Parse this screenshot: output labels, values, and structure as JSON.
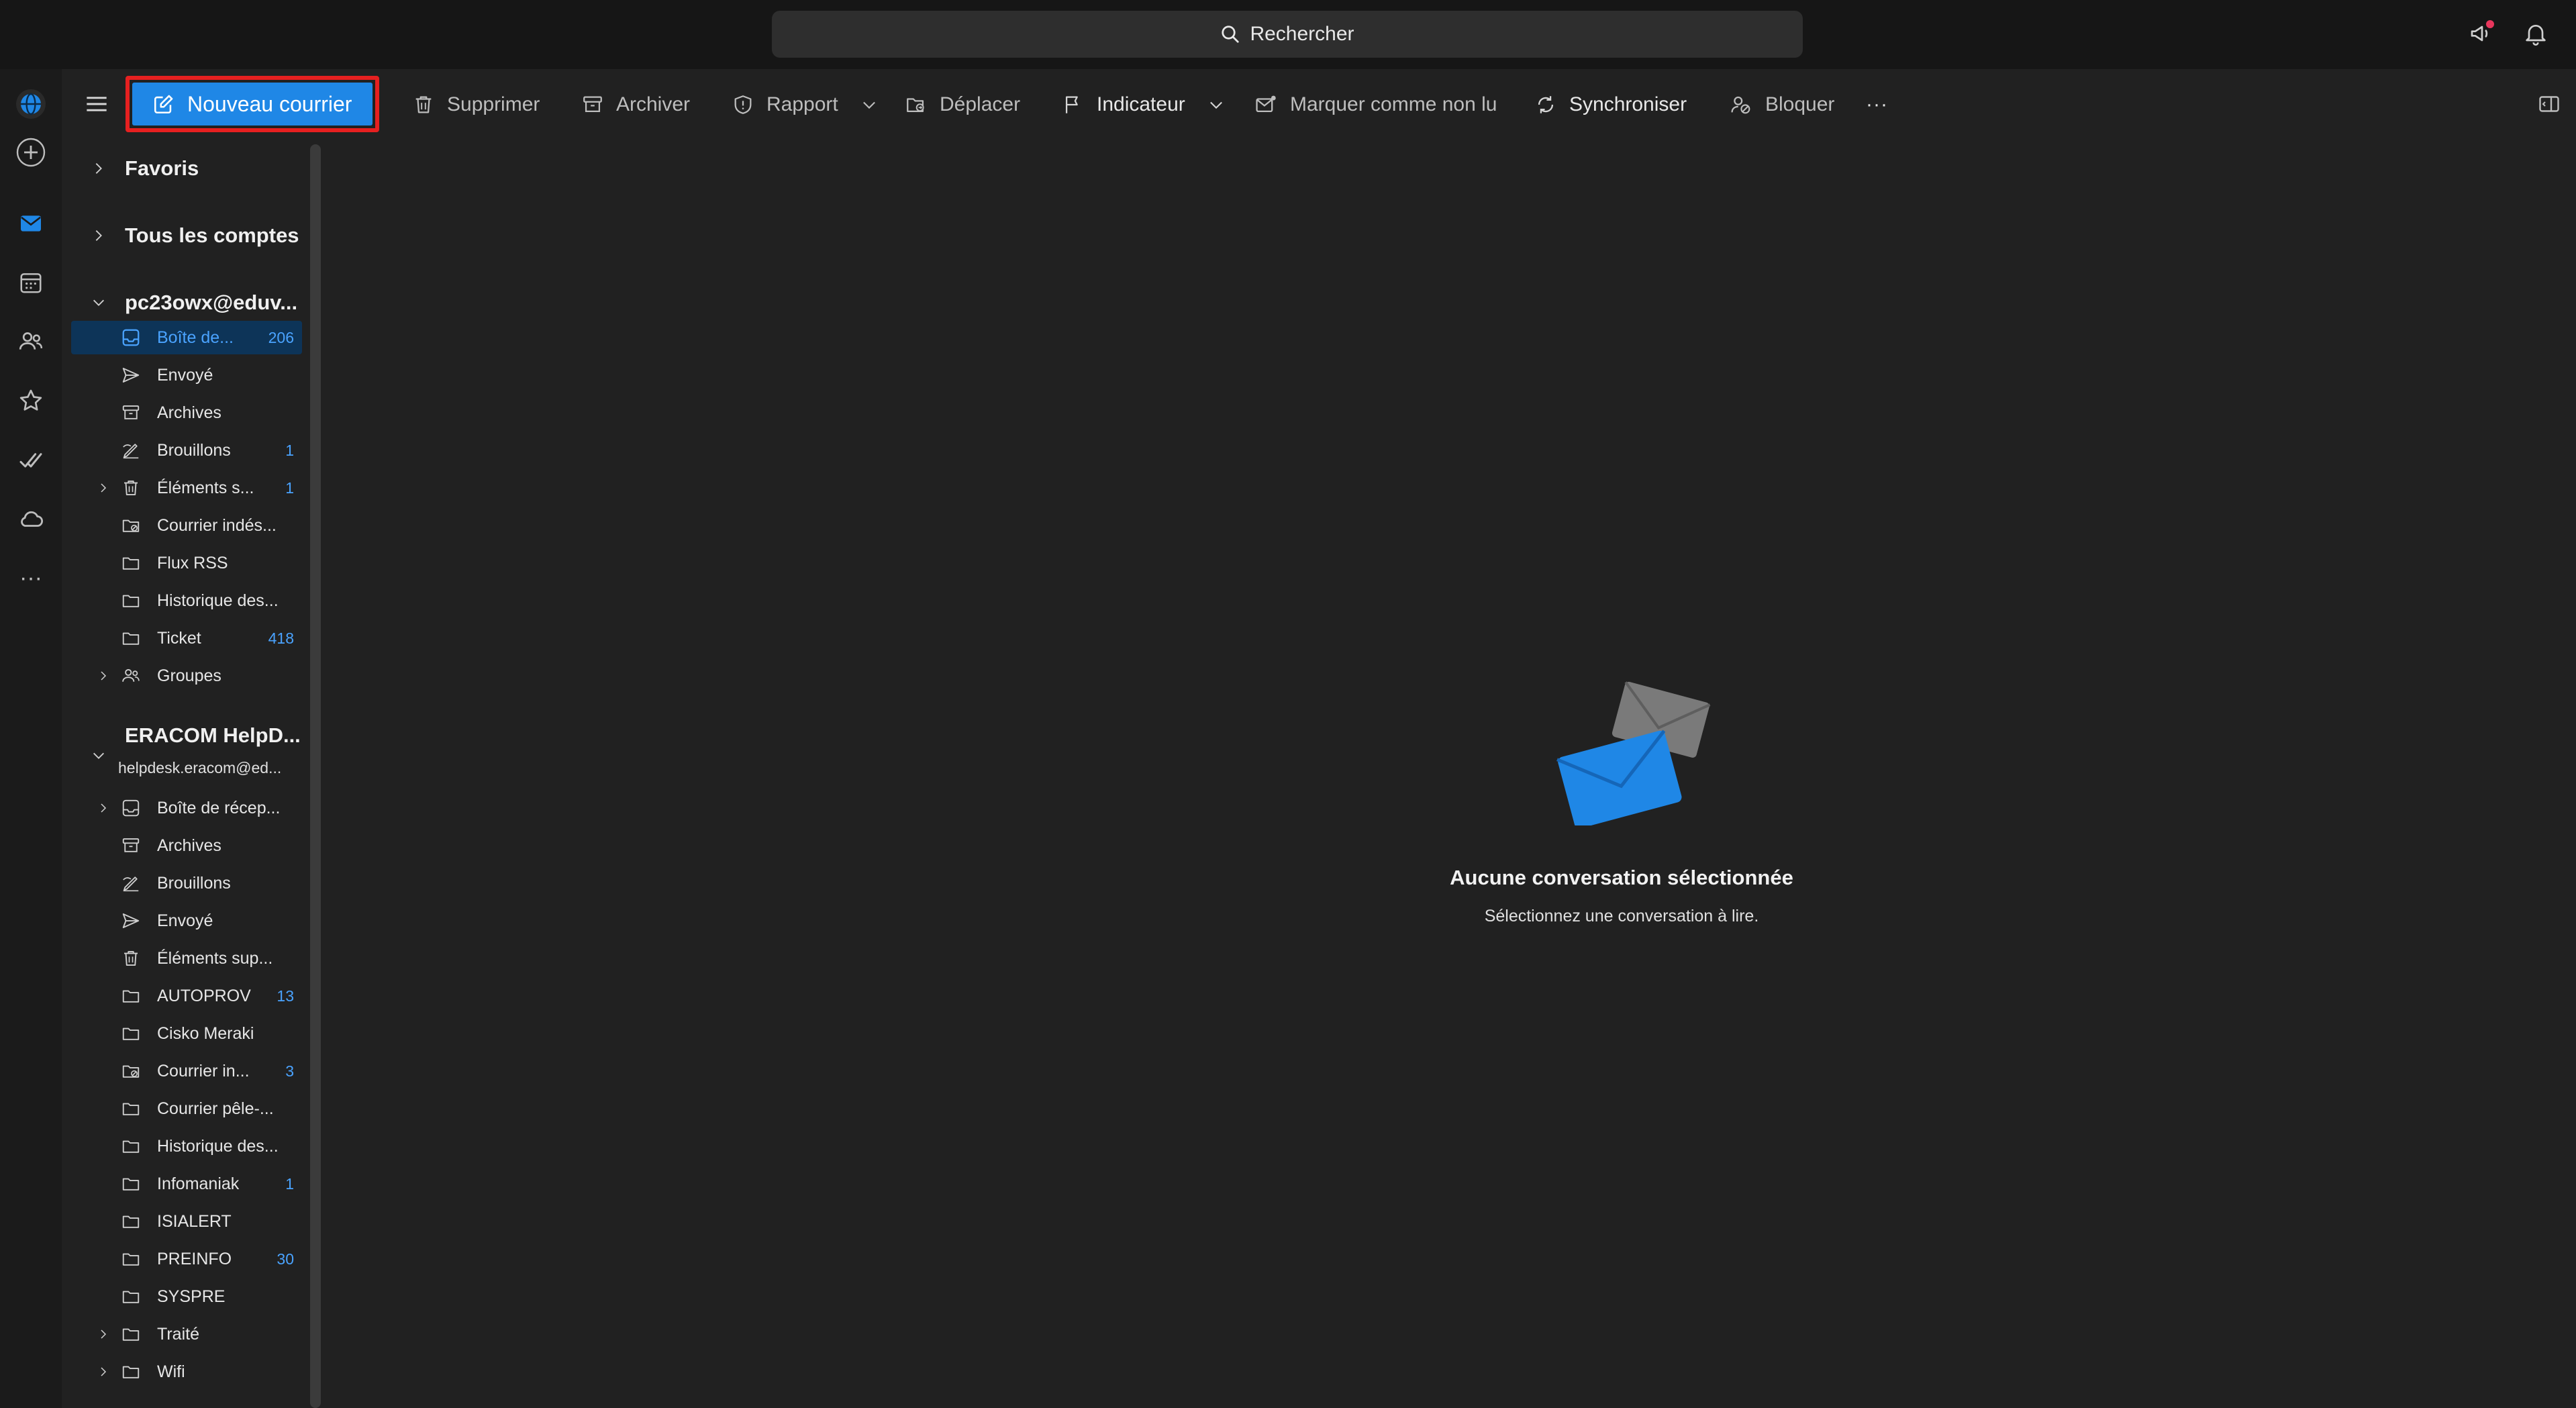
{
  "search": {
    "label": "Rechercher"
  },
  "toolbar": {
    "new_mail": "Nouveau courrier",
    "delete": "Supprimer",
    "archive": "Archiver",
    "report": "Rapport",
    "move": "Déplacer",
    "flag": "Indicateur",
    "mark_unread": "Marquer comme non lu",
    "sync": "Synchroniser",
    "block": "Bloquer",
    "more": "···"
  },
  "rail": {
    "more": "···"
  },
  "folders": {
    "favorites": "Favoris",
    "all_accounts": "Tous les comptes",
    "account1": {
      "name": "pc23owx@eduv...",
      "items": [
        {
          "label": "Boîte de...",
          "count": "206"
        },
        {
          "label": "Envoyé",
          "count": ""
        },
        {
          "label": "Archives",
          "count": ""
        },
        {
          "label": "Brouillons",
          "count": "1"
        },
        {
          "label": "Éléments s...",
          "count": "1"
        },
        {
          "label": "Courrier indés...",
          "count": ""
        },
        {
          "label": "Flux RSS",
          "count": ""
        },
        {
          "label": "Historique des...",
          "count": ""
        },
        {
          "label": "Ticket",
          "count": "418"
        },
        {
          "label": "Groupes",
          "count": ""
        }
      ]
    },
    "account2": {
      "name": "ERACOM HelpD...",
      "email": "helpdesk.eracom@ed...",
      "items": [
        {
          "label": "Boîte de récep...",
          "count": ""
        },
        {
          "label": "Archives",
          "count": ""
        },
        {
          "label": "Brouillons",
          "count": ""
        },
        {
          "label": "Envoyé",
          "count": ""
        },
        {
          "label": "Éléments sup...",
          "count": ""
        },
        {
          "label": "AUTOPROV",
          "count": "13"
        },
        {
          "label": "Cisko Meraki",
          "count": ""
        },
        {
          "label": "Courrier in...",
          "count": "3"
        },
        {
          "label": "Courrier pêle-...",
          "count": ""
        },
        {
          "label": "Historique des...",
          "count": ""
        },
        {
          "label": "Infomaniak",
          "count": "1"
        },
        {
          "label": "ISIALERT",
          "count": ""
        },
        {
          "label": "PREINFO",
          "count": "30"
        },
        {
          "label": "SYSPRE",
          "count": ""
        },
        {
          "label": "Traité",
          "count": ""
        },
        {
          "label": "Wifi",
          "count": ""
        }
      ]
    }
  },
  "reading": {
    "title": "Aucune conversation sélectionnée",
    "subtitle": "Sélectionnez une conversation à lire."
  },
  "colors": {
    "accent": "#1f87e6",
    "highlight_border": "#e62020",
    "selected_bg": "#0d3458",
    "count": "#4aa3ff"
  }
}
